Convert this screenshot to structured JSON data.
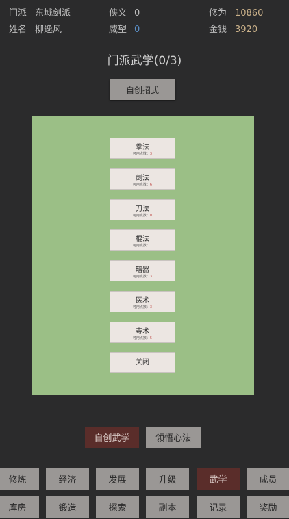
{
  "stats": {
    "sect": {
      "label": "门派",
      "value": "东城剑派"
    },
    "chivalry": {
      "label": "侠义",
      "value": "0"
    },
    "cultivation": {
      "label": "修为",
      "value": "10860"
    },
    "name": {
      "label": "姓名",
      "value": "柳逸风"
    },
    "prestige": {
      "label": "威望",
      "value": "0"
    },
    "money": {
      "label": "金钱",
      "value": "3920"
    }
  },
  "colors": {
    "cultivation_value": "#c9b089",
    "money_value": "#c9b089",
    "prestige_value": "#5b8fc7",
    "panel_bg": "#9bbf86",
    "active_tab": "#5a2d2a"
  },
  "title": "门派武学(0/3)",
  "create_move_label": "自创招式",
  "skills": [
    {
      "name": "拳法",
      "sub": "可用点数：",
      "num": "3"
    },
    {
      "name": "剑法",
      "sub": "可用点数：",
      "num": "6"
    },
    {
      "name": "刀法",
      "sub": "可用点数：",
      "num": "0"
    },
    {
      "name": "棍法",
      "sub": "可用点数：",
      "num": "1"
    },
    {
      "name": "暗器",
      "sub": "可用点数：",
      "num": "3"
    },
    {
      "name": "医术",
      "sub": "可用点数：",
      "num": "3"
    },
    {
      "name": "毒术",
      "sub": "可用点数：",
      "num": "5"
    }
  ],
  "close_label": "关闭",
  "mid_buttons": {
    "create_martial": "自创武学",
    "comprehend": "领悟心法"
  },
  "nav_row1": [
    "修炼",
    "经济",
    "发展",
    "升级",
    "武学",
    "成员"
  ],
  "nav_row2": [
    "库房",
    "锻造",
    "探索",
    "副本",
    "记录",
    "奖励"
  ],
  "active_tab": "武学"
}
